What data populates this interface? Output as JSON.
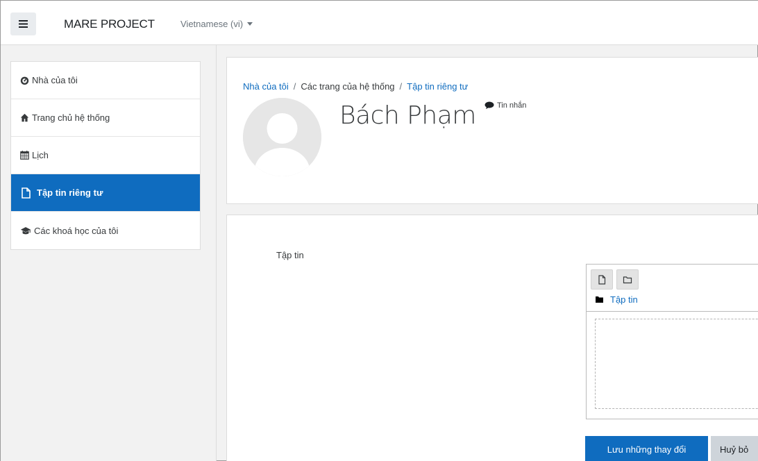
{
  "navbar": {
    "menu_icon": "hamburger-icon",
    "brand": "MARE PROJECT",
    "language": "Vietnamese (vi)"
  },
  "sidebar": {
    "items": [
      {
        "label": "Nhà của tôi",
        "icon": "dashboard-icon",
        "active": false
      },
      {
        "label": "Trang chủ hệ thống",
        "icon": "home-icon",
        "active": false
      },
      {
        "label": "Lịch",
        "icon": "calendar-icon",
        "active": false
      },
      {
        "label": "Tập tin riêng tư",
        "icon": "file-icon",
        "active": true
      },
      {
        "label": "Các khoá học của tôi",
        "icon": "graduation-cap-icon",
        "active": false
      }
    ]
  },
  "header": {
    "breadcrumb": [
      {
        "label": "Nhà của tôi",
        "link": true
      },
      {
        "label": "Các trang của hệ thống",
        "link": false
      },
      {
        "label": "Tập tin riêng tư",
        "link": true
      }
    ],
    "user_name": "Bách Phạm",
    "message_label": "Tin nhắn"
  },
  "files": {
    "field_label": "Tập tin",
    "path_label": "Tập tin",
    "save_label": "Lưu những thay đổi",
    "cancel_label": "Huỷ bỏ"
  },
  "colors": {
    "accent": "#0f6cbf",
    "secondary_button": "#ced4da",
    "background": "#f2f2f2"
  }
}
